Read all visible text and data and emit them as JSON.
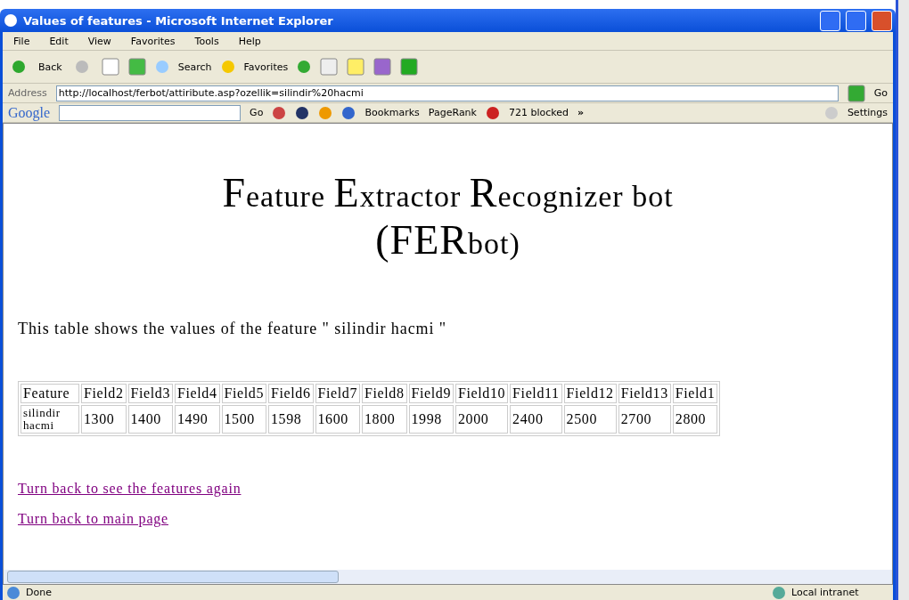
{
  "window": {
    "title": "Values of features - Microsoft Internet Explorer"
  },
  "menu": [
    "File",
    "Edit",
    "View",
    "Favorites",
    "Tools",
    "Help"
  ],
  "toolbar": {
    "back": "Back",
    "search": "Search",
    "favorites": "Favorites"
  },
  "address": {
    "label": "Address",
    "value": "http://localhost/ferbot/attiribute.asp?ozellik=silindir%20hacmi",
    "go": "Go"
  },
  "google_bar": {
    "logo": "Google",
    "go": "Go",
    "bookmarks": "Bookmarks",
    "pagerank": "PageRank",
    "blocked": "721 blocked",
    "more": "»",
    "settings": "Settings"
  },
  "page": {
    "heading": [
      {
        "text": "F",
        "large": true
      },
      {
        "text": "eature ",
        "large": false
      },
      {
        "text": "E",
        "large": true
      },
      {
        "text": "xtractor ",
        "large": false
      },
      {
        "text": "R",
        "large": true
      },
      {
        "text": "ecognizer bot",
        "large": false
      }
    ],
    "heading_line2": [
      {
        "text": "(FER",
        "large": true
      },
      {
        "text": "bot)",
        "large": false
      }
    ],
    "intro": "This table shows the values of the feature \" silindir hacmi \"",
    "table": {
      "columns": [
        "Feature",
        "Field2",
        "Field3",
        "Field4",
        "Field5",
        "Field6",
        "Field7",
        "Field8",
        "Field9",
        "Field10",
        "Field11",
        "Field12",
        "Field13",
        "Field1"
      ],
      "rows": [
        [
          "silindir hacmi",
          "1300",
          "1400",
          "1490",
          "1500",
          "1598",
          "1600",
          "1800",
          "1998",
          "2000",
          "2400",
          "2500",
          "2700",
          "2800"
        ]
      ]
    },
    "links": [
      "Turn back to see the features again",
      "Turn back to main page"
    ]
  },
  "status_bar": {
    "text": "Done",
    "zone": "Local intranet"
  }
}
